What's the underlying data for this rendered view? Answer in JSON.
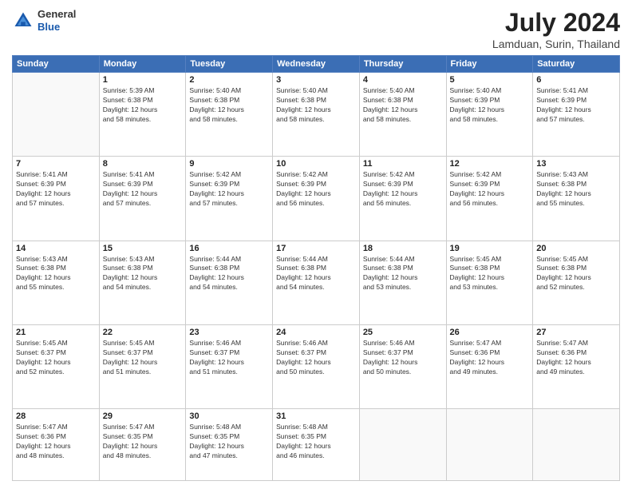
{
  "header": {
    "logo_general": "General",
    "logo_blue": "Blue",
    "month_year": "July 2024",
    "location": "Lamduan, Surin, Thailand"
  },
  "days_of_week": [
    "Sunday",
    "Monday",
    "Tuesday",
    "Wednesday",
    "Thursday",
    "Friday",
    "Saturday"
  ],
  "weeks": [
    [
      {
        "day": "",
        "info": ""
      },
      {
        "day": "1",
        "info": "Sunrise: 5:39 AM\nSunset: 6:38 PM\nDaylight: 12 hours\nand 58 minutes."
      },
      {
        "day": "2",
        "info": "Sunrise: 5:40 AM\nSunset: 6:38 PM\nDaylight: 12 hours\nand 58 minutes."
      },
      {
        "day": "3",
        "info": "Sunrise: 5:40 AM\nSunset: 6:38 PM\nDaylight: 12 hours\nand 58 minutes."
      },
      {
        "day": "4",
        "info": "Sunrise: 5:40 AM\nSunset: 6:38 PM\nDaylight: 12 hours\nand 58 minutes."
      },
      {
        "day": "5",
        "info": "Sunrise: 5:40 AM\nSunset: 6:39 PM\nDaylight: 12 hours\nand 58 minutes."
      },
      {
        "day": "6",
        "info": "Sunrise: 5:41 AM\nSunset: 6:39 PM\nDaylight: 12 hours\nand 57 minutes."
      }
    ],
    [
      {
        "day": "7",
        "info": "Sunrise: 5:41 AM\nSunset: 6:39 PM\nDaylight: 12 hours\nand 57 minutes."
      },
      {
        "day": "8",
        "info": "Sunrise: 5:41 AM\nSunset: 6:39 PM\nDaylight: 12 hours\nand 57 minutes."
      },
      {
        "day": "9",
        "info": "Sunrise: 5:42 AM\nSunset: 6:39 PM\nDaylight: 12 hours\nand 57 minutes."
      },
      {
        "day": "10",
        "info": "Sunrise: 5:42 AM\nSunset: 6:39 PM\nDaylight: 12 hours\nand 56 minutes."
      },
      {
        "day": "11",
        "info": "Sunrise: 5:42 AM\nSunset: 6:39 PM\nDaylight: 12 hours\nand 56 minutes."
      },
      {
        "day": "12",
        "info": "Sunrise: 5:42 AM\nSunset: 6:39 PM\nDaylight: 12 hours\nand 56 minutes."
      },
      {
        "day": "13",
        "info": "Sunrise: 5:43 AM\nSunset: 6:38 PM\nDaylight: 12 hours\nand 55 minutes."
      }
    ],
    [
      {
        "day": "14",
        "info": "Sunrise: 5:43 AM\nSunset: 6:38 PM\nDaylight: 12 hours\nand 55 minutes."
      },
      {
        "day": "15",
        "info": "Sunrise: 5:43 AM\nSunset: 6:38 PM\nDaylight: 12 hours\nand 54 minutes."
      },
      {
        "day": "16",
        "info": "Sunrise: 5:44 AM\nSunset: 6:38 PM\nDaylight: 12 hours\nand 54 minutes."
      },
      {
        "day": "17",
        "info": "Sunrise: 5:44 AM\nSunset: 6:38 PM\nDaylight: 12 hours\nand 54 minutes."
      },
      {
        "day": "18",
        "info": "Sunrise: 5:44 AM\nSunset: 6:38 PM\nDaylight: 12 hours\nand 53 minutes."
      },
      {
        "day": "19",
        "info": "Sunrise: 5:45 AM\nSunset: 6:38 PM\nDaylight: 12 hours\nand 53 minutes."
      },
      {
        "day": "20",
        "info": "Sunrise: 5:45 AM\nSunset: 6:38 PM\nDaylight: 12 hours\nand 52 minutes."
      }
    ],
    [
      {
        "day": "21",
        "info": "Sunrise: 5:45 AM\nSunset: 6:37 PM\nDaylight: 12 hours\nand 52 minutes."
      },
      {
        "day": "22",
        "info": "Sunrise: 5:45 AM\nSunset: 6:37 PM\nDaylight: 12 hours\nand 51 minutes."
      },
      {
        "day": "23",
        "info": "Sunrise: 5:46 AM\nSunset: 6:37 PM\nDaylight: 12 hours\nand 51 minutes."
      },
      {
        "day": "24",
        "info": "Sunrise: 5:46 AM\nSunset: 6:37 PM\nDaylight: 12 hours\nand 50 minutes."
      },
      {
        "day": "25",
        "info": "Sunrise: 5:46 AM\nSunset: 6:37 PM\nDaylight: 12 hours\nand 50 minutes."
      },
      {
        "day": "26",
        "info": "Sunrise: 5:47 AM\nSunset: 6:36 PM\nDaylight: 12 hours\nand 49 minutes."
      },
      {
        "day": "27",
        "info": "Sunrise: 5:47 AM\nSunset: 6:36 PM\nDaylight: 12 hours\nand 49 minutes."
      }
    ],
    [
      {
        "day": "28",
        "info": "Sunrise: 5:47 AM\nSunset: 6:36 PM\nDaylight: 12 hours\nand 48 minutes."
      },
      {
        "day": "29",
        "info": "Sunrise: 5:47 AM\nSunset: 6:35 PM\nDaylight: 12 hours\nand 48 minutes."
      },
      {
        "day": "30",
        "info": "Sunrise: 5:48 AM\nSunset: 6:35 PM\nDaylight: 12 hours\nand 47 minutes."
      },
      {
        "day": "31",
        "info": "Sunrise: 5:48 AM\nSunset: 6:35 PM\nDaylight: 12 hours\nand 46 minutes."
      },
      {
        "day": "",
        "info": ""
      },
      {
        "day": "",
        "info": ""
      },
      {
        "day": "",
        "info": ""
      }
    ]
  ]
}
